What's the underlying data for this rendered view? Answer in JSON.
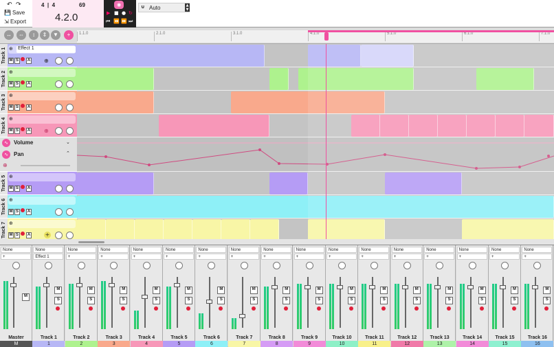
{
  "toolbar": {
    "save_label": "Save",
    "export_label": "Export",
    "time_sig": "4  |  4",
    "tempo": "69",
    "position": "4.2.0",
    "sync_mode": "Auto"
  },
  "ruler": {
    "ticks": [
      "1.1.0",
      "2.1.0",
      "3.1.0",
      "4.1.0",
      "5.1.0",
      "6.1.0",
      "7.1.0"
    ]
  },
  "tracks": [
    {
      "name": "Track 1",
      "effect": "Effect 1",
      "color": "#b7b7f5"
    },
    {
      "name": "Track 2",
      "color": "#aef28e"
    },
    {
      "name": "Track 3",
      "color": "#f9a98c"
    },
    {
      "name": "Track 4",
      "color": "#f797b8"
    },
    {
      "name": "Track 5",
      "color": "#b59cf5"
    },
    {
      "name": "Track 6",
      "color": "#8ef0f7"
    },
    {
      "name": "Track 7",
      "color": "#f8f6a6"
    }
  ],
  "automation": {
    "volume_label": "Volume",
    "pan_label": "Pan"
  },
  "mixer": {
    "input_none": "None",
    "effect_1": "Effect 1",
    "mute": "M",
    "solo": "S",
    "strips": [
      {
        "name": "Master",
        "num": "M",
        "color": "#555"
      },
      {
        "name": "Track 1",
        "num": "1",
        "color": "#b7b7f5"
      },
      {
        "name": "Track 2",
        "num": "2",
        "color": "#aef28e"
      },
      {
        "name": "Track 3",
        "num": "3",
        "color": "#f9a98c"
      },
      {
        "name": "Track 4",
        "num": "4",
        "color": "#f797b8"
      },
      {
        "name": "Track 5",
        "num": "5",
        "color": "#b59cf5"
      },
      {
        "name": "Track 6",
        "num": "6",
        "color": "#8ef0f7"
      },
      {
        "name": "Track 7",
        "num": "7",
        "color": "#f8f6a6"
      },
      {
        "name": "Track 8",
        "num": "8",
        "color": "#d59cf5"
      },
      {
        "name": "Track 9",
        "num": "9",
        "color": "#f28bd8"
      },
      {
        "name": "Track 10",
        "num": "10",
        "color": "#8ef0c7"
      },
      {
        "name": "Track 11",
        "num": "11",
        "color": "#f8f08a"
      },
      {
        "name": "Track 12",
        "num": "12",
        "color": "#f07aa8"
      },
      {
        "name": "Track 13",
        "num": "13",
        "color": "#aef2a8"
      },
      {
        "name": "Track 14",
        "num": "14",
        "color": "#f28bd8"
      },
      {
        "name": "Track 15",
        "num": "15",
        "color": "#8ef0d0"
      },
      {
        "name": "Track 16",
        "num": "16",
        "color": "#8ec0f0"
      }
    ]
  }
}
